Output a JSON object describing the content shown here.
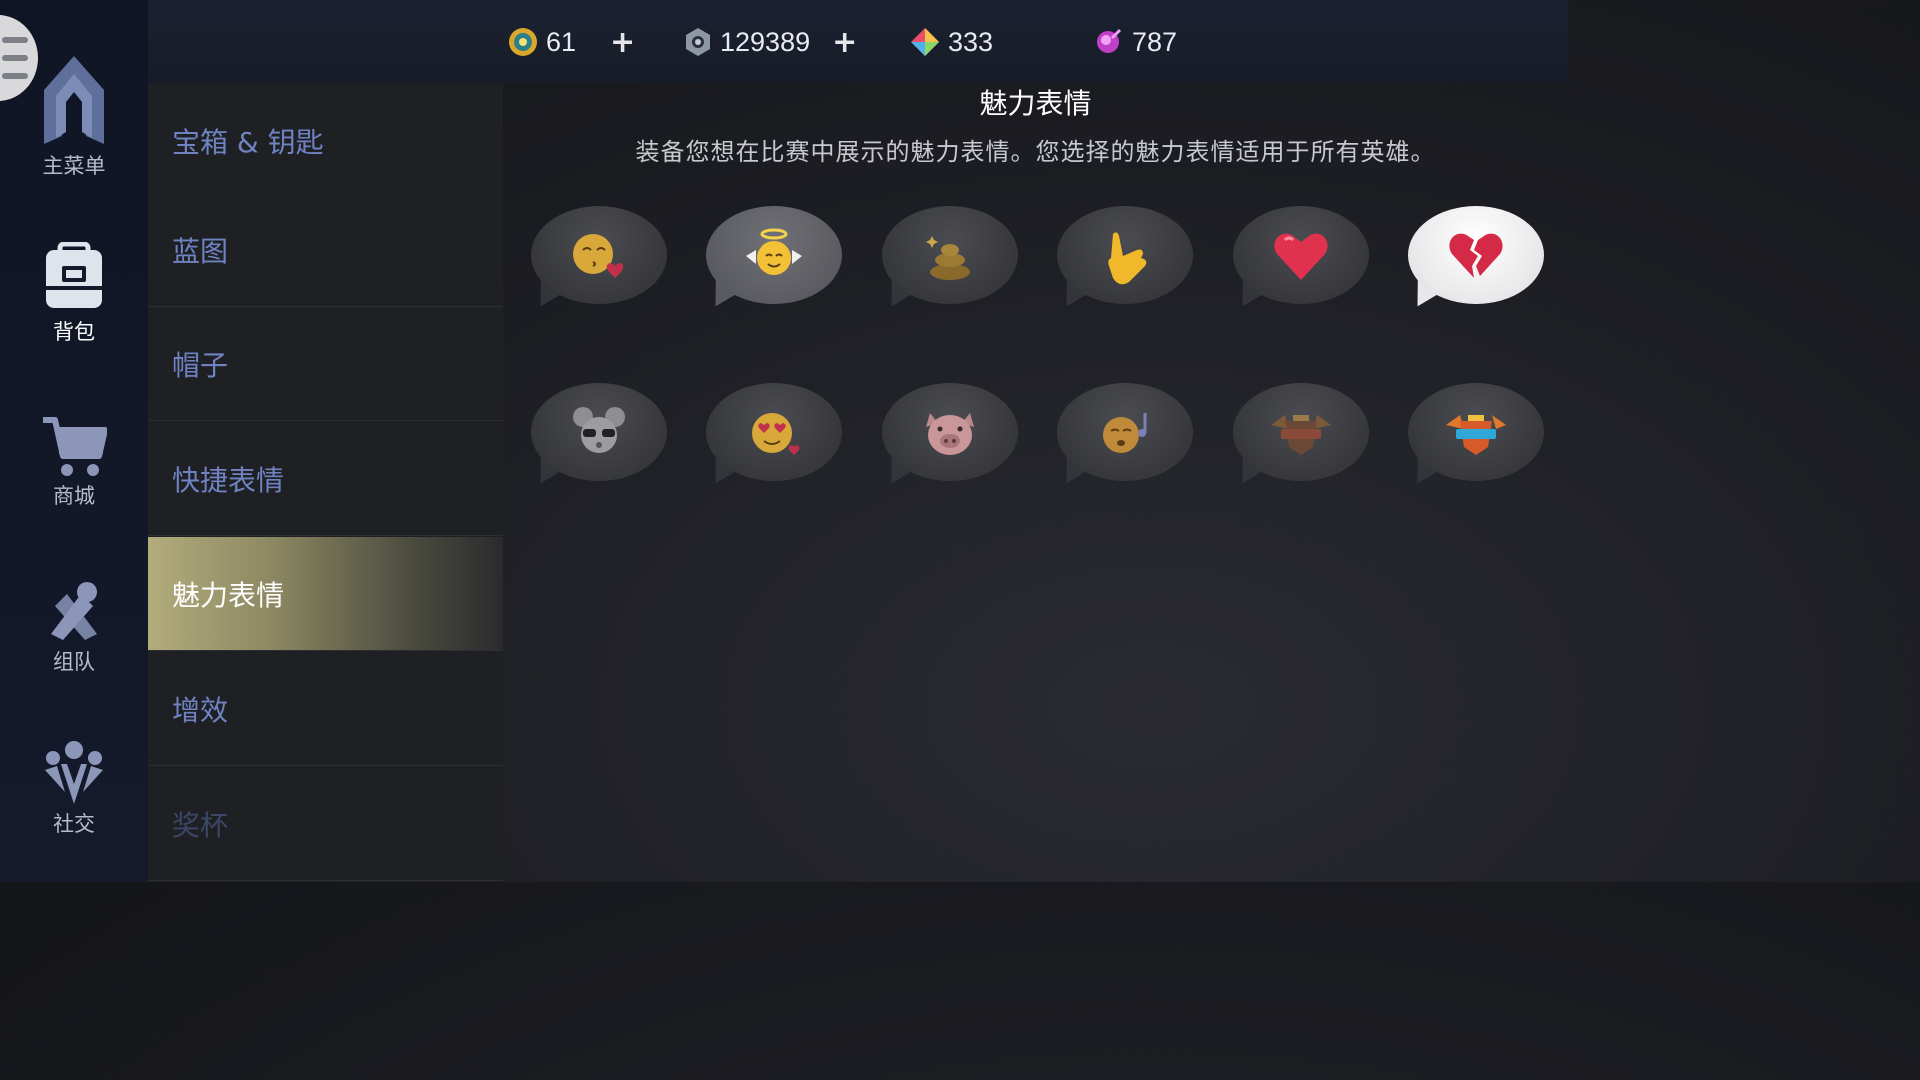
{
  "sidebar": {
    "items": [
      {
        "label": "主菜单",
        "icon": "main-menu-icon"
      },
      {
        "label": "背包",
        "icon": "backpack-icon"
      },
      {
        "label": "商城",
        "icon": "cart-icon"
      },
      {
        "label": "组队",
        "icon": "team-icon"
      },
      {
        "label": "社交",
        "icon": "social-icon"
      }
    ]
  },
  "currency": {
    "gold": "61",
    "blue_essence": "129389",
    "gems": "333",
    "orbs": "787",
    "plus": "+"
  },
  "categories": [
    {
      "label": "宝箱 & 钥匙"
    },
    {
      "label": "蓝图"
    },
    {
      "label": "帽子"
    },
    {
      "label": "快捷表情"
    },
    {
      "label": "魅力表情",
      "selected": true
    },
    {
      "label": "增效"
    },
    {
      "label": "奖杯"
    }
  ],
  "main": {
    "title": "魅力表情",
    "description": "装备您想在比赛中展示的魅力表情。您选择的魅力表情适用于所有英雄。"
  },
  "emotes": [
    {
      "icon": "kiss-face-heart-icon"
    },
    {
      "icon": "angel-face-icon"
    },
    {
      "icon": "poop-icon"
    },
    {
      "icon": "shaka-hand-icon"
    },
    {
      "icon": "heart-icon"
    },
    {
      "icon": "broken-heart-icon",
      "selected": true
    },
    {
      "icon": "mouse-sunglasses-icon"
    },
    {
      "icon": "heart-eyes-face-icon"
    },
    {
      "icon": "pig-face-icon"
    },
    {
      "icon": "singing-face-icon"
    },
    {
      "icon": "cvpl-2019-badge-icon"
    },
    {
      "icon": "cvpl-2019-badge-color-icon"
    }
  ],
  "colors": {
    "category_text": "#6f83c2",
    "selected_gradient_start": "#b2ac7c"
  }
}
